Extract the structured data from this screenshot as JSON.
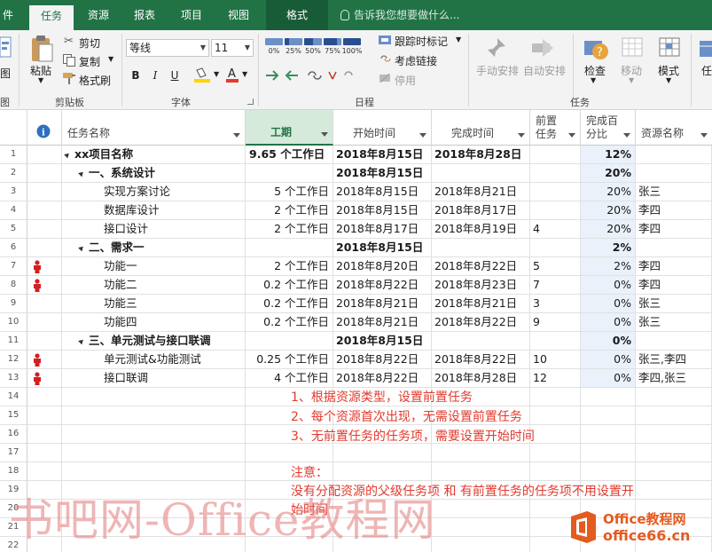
{
  "tabs": {
    "file": "件",
    "task": "任务",
    "resource": "资源",
    "report": "报表",
    "project": "项目",
    "view": "视图",
    "format": "格式",
    "tell_me": "告诉我您想要做什么..."
  },
  "ribbon": {
    "view_left": "图",
    "paste": "粘贴",
    "cut": "剪切",
    "copy": "复制",
    "format_painter": "格式刷",
    "font_name": "等线",
    "font_size": "11",
    "bold": "B",
    "italic": "I",
    "underline": "U",
    "schedule_pcts": [
      "0%",
      "25%",
      "50%",
      "75%",
      "100%"
    ],
    "track_mark": "跟踪时标记",
    "respect_links": "考虑链接",
    "inactivate": "停用",
    "manual": "手动安排",
    "auto": "自动安排",
    "inspect": "检查",
    "move": "移动",
    "mode": "模式",
    "right_cut": "任",
    "groups": {
      "clipboard": "剪贴板",
      "font": "字体",
      "schedule": "日程",
      "tasks": "任务",
      "left": "图"
    }
  },
  "columns": {
    "info": "i",
    "name": "任务名称",
    "duration": "工期",
    "start": "开始时间",
    "finish": "完成时间",
    "pred_l1": "前置",
    "pred_l2": "任务",
    "pct_l1": "完成百",
    "pct_l2": "分比",
    "resource": "资源名称"
  },
  "rows": [
    {
      "id": "1",
      "name": "xx项目名称",
      "duration": "9.65 个工作日",
      "start": "2018年8月15日",
      "finish": "2018年8月28日",
      "pred": "",
      "pct": "12%",
      "res": "",
      "level": 0,
      "summary": true,
      "person": false
    },
    {
      "id": "2",
      "name": "一、系统设计",
      "duration": "",
      "start": "2018年8月15日",
      "finish": "",
      "pred": "",
      "pct": "20%",
      "res": "",
      "level": 1,
      "summary": true,
      "person": false
    },
    {
      "id": "3",
      "name": "实现方案讨论",
      "duration": "5 个工作日",
      "start": "2018年8月15日",
      "finish": "2018年8月21日",
      "pred": "",
      "pct": "20%",
      "res": "张三",
      "level": 2,
      "summary": false,
      "person": false
    },
    {
      "id": "4",
      "name": "数据库设计",
      "duration": "2 个工作日",
      "start": "2018年8月15日",
      "finish": "2018年8月17日",
      "pred": "",
      "pct": "20%",
      "res": "李四",
      "level": 2,
      "summary": false,
      "person": false
    },
    {
      "id": "5",
      "name": "接口设计",
      "duration": "2 个工作日",
      "start": "2018年8月17日",
      "finish": "2018年8月19日",
      "pred": "4",
      "pct": "20%",
      "res": "李四",
      "level": 2,
      "summary": false,
      "person": false
    },
    {
      "id": "6",
      "name": "二、需求一",
      "duration": "",
      "start": "2018年8月15日",
      "finish": "",
      "pred": "",
      "pct": "2%",
      "res": "",
      "level": 1,
      "summary": true,
      "person": false
    },
    {
      "id": "7",
      "name": "功能一",
      "duration": "2 个工作日",
      "start": "2018年8月20日",
      "finish": "2018年8月22日",
      "pred": "5",
      "pct": "2%",
      "res": "李四",
      "level": 2,
      "summary": false,
      "person": true
    },
    {
      "id": "8",
      "name": "功能二",
      "duration": "0.2 个工作日",
      "start": "2018年8月22日",
      "finish": "2018年8月23日",
      "pred": "7",
      "pct": "0%",
      "res": "李四",
      "level": 2,
      "summary": false,
      "person": true
    },
    {
      "id": "9",
      "name": "功能三",
      "duration": "0.2 个工作日",
      "start": "2018年8月21日",
      "finish": "2018年8月21日",
      "pred": "3",
      "pct": "0%",
      "res": "张三",
      "level": 2,
      "summary": false,
      "person": false
    },
    {
      "id": "10",
      "name": "功能四",
      "duration": "0.2 个工作日",
      "start": "2018年8月21日",
      "finish": "2018年8月22日",
      "pred": "9",
      "pct": "0%",
      "res": "张三",
      "level": 2,
      "summary": false,
      "person": false
    },
    {
      "id": "11",
      "name": "三、单元测试与接口联调",
      "duration": "",
      "start": "2018年8月15日",
      "finish": "",
      "pred": "",
      "pct": "0%",
      "res": "",
      "level": 1,
      "summary": true,
      "person": false
    },
    {
      "id": "12",
      "name": "单元测试&功能测试",
      "duration": "0.25 个工作日",
      "start": "2018年8月22日",
      "finish": "2018年8月22日",
      "pred": "10",
      "pct": "0%",
      "res": "张三,李四",
      "level": 2,
      "summary": false,
      "person": true
    },
    {
      "id": "13",
      "name": "接口联调",
      "duration": "4 个工作日",
      "start": "2018年8月22日",
      "finish": "2018年8月28日",
      "pred": "12",
      "pct": "0%",
      "res": "李四,张三",
      "level": 2,
      "summary": false,
      "person": true
    }
  ],
  "empty_row_ids": [
    "14",
    "15",
    "16",
    "17",
    "18",
    "19",
    "20",
    "21",
    "22"
  ],
  "notes": {
    "n1": "1、根据资源类型，设置前置任务",
    "n2": "2、每个资源首次出现，无需设置前置任务",
    "n3": "3、无前置任务的任务项，需要设置开始时间",
    "attention": "注意：",
    "n4": "没有分配资源的父级任务项 和 有前置任务的任务项不用设置开",
    "n5": "始时间"
  },
  "watermark": "书吧网-Office教程网",
  "logo": {
    "line1": "Office教程网",
    "line2": "office66.cn"
  },
  "colors": {
    "ribbon_green": "#217346",
    "note_red": "#e23a2e",
    "person_red": "#d21f1f"
  }
}
